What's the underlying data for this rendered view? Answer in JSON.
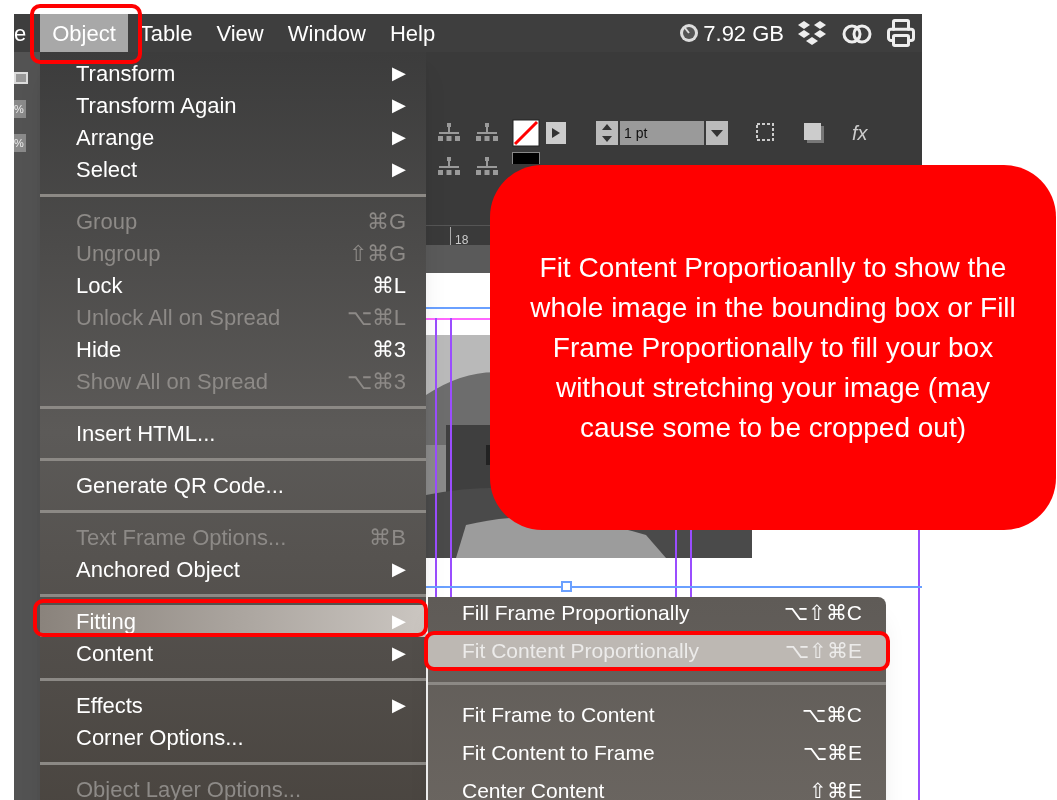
{
  "menu_bar": {
    "items": [
      {
        "label": "e",
        "selected": false
      },
      {
        "label": "Object",
        "selected": true
      },
      {
        "label": "Table",
        "selected": false
      },
      {
        "label": "View",
        "selected": false
      },
      {
        "label": "Window",
        "selected": false
      },
      {
        "label": "Help",
        "selected": false
      }
    ],
    "memory": "7.92 GB"
  },
  "left_panel": {
    "fields": [
      "%",
      "%"
    ]
  },
  "toolbar": {
    "stroke_weight": "1 pt",
    "effects_label": "fx"
  },
  "ruler": {
    "label": "18"
  },
  "object_menu": {
    "items": [
      {
        "kind": "item",
        "label": "Transform",
        "arrow": "▶",
        "disabled": false,
        "selected": false
      },
      {
        "kind": "item",
        "label": "Transform Again",
        "arrow": "▶",
        "disabled": false,
        "selected": false
      },
      {
        "kind": "item",
        "label": "Arrange",
        "arrow": "▶",
        "disabled": false,
        "selected": false
      },
      {
        "kind": "item",
        "label": "Select",
        "arrow": "▶",
        "disabled": false,
        "selected": false
      },
      {
        "kind": "separator"
      },
      {
        "kind": "item",
        "label": "Group",
        "shortcut": "⌘G",
        "disabled": true,
        "selected": false
      },
      {
        "kind": "item",
        "label": "Ungroup",
        "shortcut": "⇧⌘G",
        "disabled": true,
        "selected": false
      },
      {
        "kind": "item",
        "label": "Lock",
        "shortcut": "⌘L",
        "disabled": false,
        "selected": false
      },
      {
        "kind": "item",
        "label": "Unlock All on Spread",
        "shortcut": "⌥⌘L",
        "disabled": true,
        "selected": false
      },
      {
        "kind": "item",
        "label": "Hide",
        "shortcut": "⌘3",
        "disabled": false,
        "selected": false
      },
      {
        "kind": "item",
        "label": "Show All on Spread",
        "shortcut": "⌥⌘3",
        "disabled": true,
        "selected": false
      },
      {
        "kind": "separator"
      },
      {
        "kind": "item",
        "label": "Insert HTML...",
        "disabled": false,
        "selected": false
      },
      {
        "kind": "separator"
      },
      {
        "kind": "item",
        "label": "Generate QR Code...",
        "disabled": false,
        "selected": false
      },
      {
        "kind": "separator"
      },
      {
        "kind": "item",
        "label": "Text Frame Options...",
        "shortcut": "⌘B",
        "disabled": true,
        "selected": false
      },
      {
        "kind": "item",
        "label": "Anchored Object",
        "arrow": "▶",
        "disabled": false,
        "selected": false
      },
      {
        "kind": "separator"
      },
      {
        "kind": "item",
        "label": "Fitting",
        "arrow": "▶",
        "disabled": false,
        "selected": true
      },
      {
        "kind": "item",
        "label": "Content",
        "arrow": "▶",
        "disabled": false,
        "selected": false
      },
      {
        "kind": "separator"
      },
      {
        "kind": "item",
        "label": "Effects",
        "arrow": "▶",
        "disabled": false,
        "selected": false
      },
      {
        "kind": "item",
        "label": "Corner Options...",
        "disabled": false,
        "selected": false
      },
      {
        "kind": "separator"
      },
      {
        "kind": "item",
        "label": "Object Layer Options...",
        "disabled": true,
        "selected": false
      }
    ]
  },
  "fitting_submenu": {
    "items": [
      {
        "kind": "item",
        "label": "Fill Frame Proportionally",
        "shortcut": "⌥⇧⌘C",
        "selected": false
      },
      {
        "kind": "item",
        "label": "Fit Content Proportionally",
        "shortcut": "⌥⇧⌘E",
        "selected": true
      },
      {
        "kind": "separator"
      },
      {
        "kind": "item",
        "label": "Fit Frame to Content",
        "shortcut": "⌥⌘C",
        "selected": false
      },
      {
        "kind": "item",
        "label": "Fit Content to Frame",
        "shortcut": "⌥⌘E",
        "selected": false
      },
      {
        "kind": "item",
        "label": "Center Content",
        "shortcut": "⇧⌘E",
        "selected": false
      }
    ]
  },
  "callout": {
    "text": "Fit Content Proportioanlly to show the whole image in the bounding box or Fill Frame Proportionally to fill your box without stretching your image (may cause some to be cropped out)"
  }
}
